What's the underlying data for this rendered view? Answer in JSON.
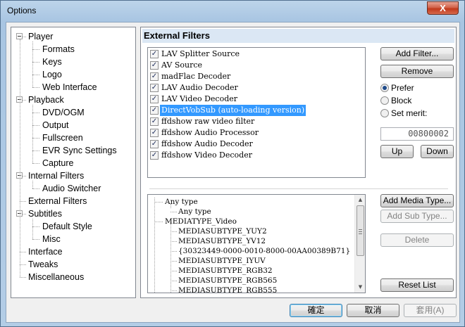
{
  "window": {
    "title": "Options",
    "close_label": "X"
  },
  "tree": {
    "items": [
      {
        "label": "Player",
        "level": 0,
        "expander": true
      },
      {
        "label": "Formats",
        "level": 1
      },
      {
        "label": "Keys",
        "level": 1
      },
      {
        "label": "Logo",
        "level": 1
      },
      {
        "label": "Web Interface",
        "level": 1
      },
      {
        "label": "Playback",
        "level": 0,
        "expander": true
      },
      {
        "label": "DVD/OGM",
        "level": 1
      },
      {
        "label": "Output",
        "level": 1
      },
      {
        "label": "Fullscreen",
        "level": 1
      },
      {
        "label": "EVR Sync Settings",
        "level": 1
      },
      {
        "label": "Capture",
        "level": 1
      },
      {
        "label": "Internal Filters",
        "level": 0,
        "expander": true
      },
      {
        "label": "Audio Switcher",
        "level": 1
      },
      {
        "label": "External Filters",
        "level": 0,
        "selected": true
      },
      {
        "label": "Subtitles",
        "level": 0,
        "expander": true
      },
      {
        "label": "Default Style",
        "level": 1
      },
      {
        "label": "Misc",
        "level": 1
      },
      {
        "label": "Interface",
        "level": 0
      },
      {
        "label": "Tweaks",
        "level": 0
      },
      {
        "label": "Miscellaneous",
        "level": 0
      }
    ]
  },
  "panel": {
    "title": "External Filters"
  },
  "filters": [
    {
      "label": "LAV Splitter Source",
      "checked": true
    },
    {
      "label": "AV Source",
      "checked": true
    },
    {
      "label": "madFlac Decoder",
      "checked": true
    },
    {
      "label": "LAV Audio Decoder",
      "checked": true
    },
    {
      "label": "LAV Video Decoder",
      "checked": true
    },
    {
      "label": "DirectVobSub (auto-loading version)",
      "checked": true,
      "selected": true
    },
    {
      "label": "ffdshow raw video filter",
      "checked": true
    },
    {
      "label": "ffdshow Audio Processor",
      "checked": true
    },
    {
      "label": "ffdshow Audio Decoder",
      "checked": true
    },
    {
      "label": "ffdshow Video Decoder",
      "checked": true
    }
  ],
  "buttons": {
    "add_filter": "Add Filter...",
    "remove": "Remove",
    "up": "Up",
    "down": "Down",
    "add_media_type": "Add Media Type...",
    "add_sub_type": "Add Sub Type...",
    "delete": "Delete",
    "reset_list": "Reset List"
  },
  "merit": {
    "prefer": "Prefer",
    "block": "Block",
    "set_merit": "Set merit:",
    "selected": "prefer",
    "value": "00800002"
  },
  "types": [
    {
      "label": "Any type",
      "level": 0
    },
    {
      "label": "Any type",
      "level": 1
    },
    {
      "label": "MEDIATYPE_Video",
      "level": 0
    },
    {
      "label": "MEDIASUBTYPE_YUY2",
      "level": 1
    },
    {
      "label": "MEDIASUBTYPE_YV12",
      "level": 1
    },
    {
      "label": "{30323449-0000-0010-8000-00AA00389B71}",
      "level": 1
    },
    {
      "label": "MEDIASUBTYPE_IYUV",
      "level": 1
    },
    {
      "label": "MEDIASUBTYPE_RGB32",
      "level": 1
    },
    {
      "label": "MEDIASUBTYPE_RGB565",
      "level": 1
    },
    {
      "label": "MEDIASUBTYPE_RGB555",
      "level": 1
    }
  ],
  "footer": {
    "ok": "確定",
    "cancel": "取消",
    "apply": "套用(A)"
  },
  "colors": {
    "selection": "#3399ff",
    "header_bg": "#dbe7f4",
    "title_glass": "#a8c5e2"
  }
}
